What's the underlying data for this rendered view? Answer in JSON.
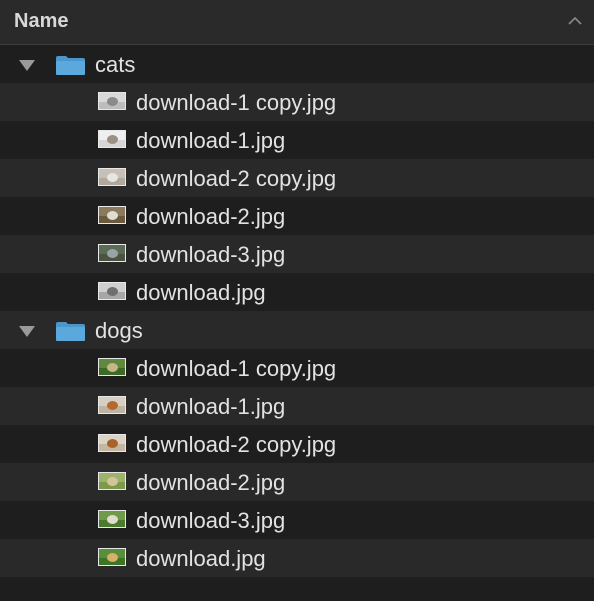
{
  "header": {
    "column_label": "Name"
  },
  "folders": [
    {
      "name": "cats",
      "files": [
        {
          "name": "download-1 copy.jpg",
          "colors": [
            "#d9d9d9",
            "#bdbdbd",
            "#8a8a8a"
          ]
        },
        {
          "name": "download-1.jpg",
          "colors": [
            "#efefef",
            "#d6d6d6",
            "#9c8f83"
          ]
        },
        {
          "name": "download-2 copy.jpg",
          "colors": [
            "#c8c0b8",
            "#b1a89e",
            "#e8e4df"
          ]
        },
        {
          "name": "download-2.jpg",
          "colors": [
            "#8c7a5c",
            "#6b5a3e",
            "#e0dcd2"
          ]
        },
        {
          "name": "download-3.jpg",
          "colors": [
            "#5c6b55",
            "#4a5440",
            "#9aa3a8"
          ]
        },
        {
          "name": "download.jpg",
          "colors": [
            "#cfcfcf",
            "#a7a7a7",
            "#6f6f6f"
          ]
        }
      ]
    },
    {
      "name": "dogs",
      "files": [
        {
          "name": "download-1 copy.jpg",
          "colors": [
            "#5f8a3e",
            "#3d6a24",
            "#c9b58a"
          ]
        },
        {
          "name": "download-1.jpg",
          "colors": [
            "#d7cfc3",
            "#bfb4a3",
            "#b56a2c"
          ]
        },
        {
          "name": "download-2 copy.jpg",
          "colors": [
            "#dcd2c6",
            "#c4b6a2",
            "#a9622a"
          ]
        },
        {
          "name": "download-2.jpg",
          "colors": [
            "#9bb36a",
            "#7d9a4c",
            "#d4c49a"
          ]
        },
        {
          "name": "download-3.jpg",
          "colors": [
            "#6e9a4a",
            "#4c7a30",
            "#e2dccb"
          ]
        },
        {
          "name": "download.jpg",
          "colors": [
            "#5a8f3a",
            "#3e7426",
            "#d8b06a"
          ]
        }
      ]
    }
  ],
  "colors": {
    "folder_blue": "#5aa8dc",
    "folder_blue_dark": "#4b97cc",
    "row_alt": "#292929"
  }
}
